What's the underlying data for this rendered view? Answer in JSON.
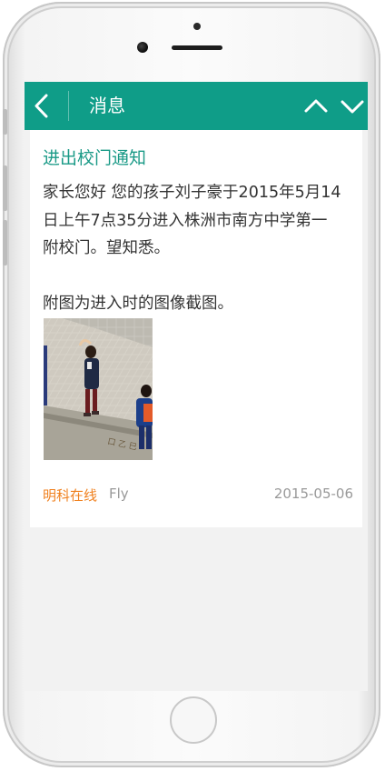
{
  "header": {
    "title": "消息"
  },
  "message": {
    "title": "进出校门通知",
    "body_lines": [
      "家长您好 您的孩子刘子豪于2015年5月14",
      "日上午7点35分进入株洲市南方中学第一",
      "附校门。望知悉。"
    ],
    "attachment_note": "附图为进入时的图像截图。",
    "source": "明科在线",
    "author": "Fly",
    "date": "2015-05-06"
  },
  "colors": {
    "header_bg": "#0f9d88",
    "title": "#1a9a87",
    "source": "#f0811f",
    "meta": "#999999"
  },
  "icons": {
    "back": "chevron-left-icon",
    "up": "chevron-up-icon",
    "down": "chevron-down-icon"
  }
}
